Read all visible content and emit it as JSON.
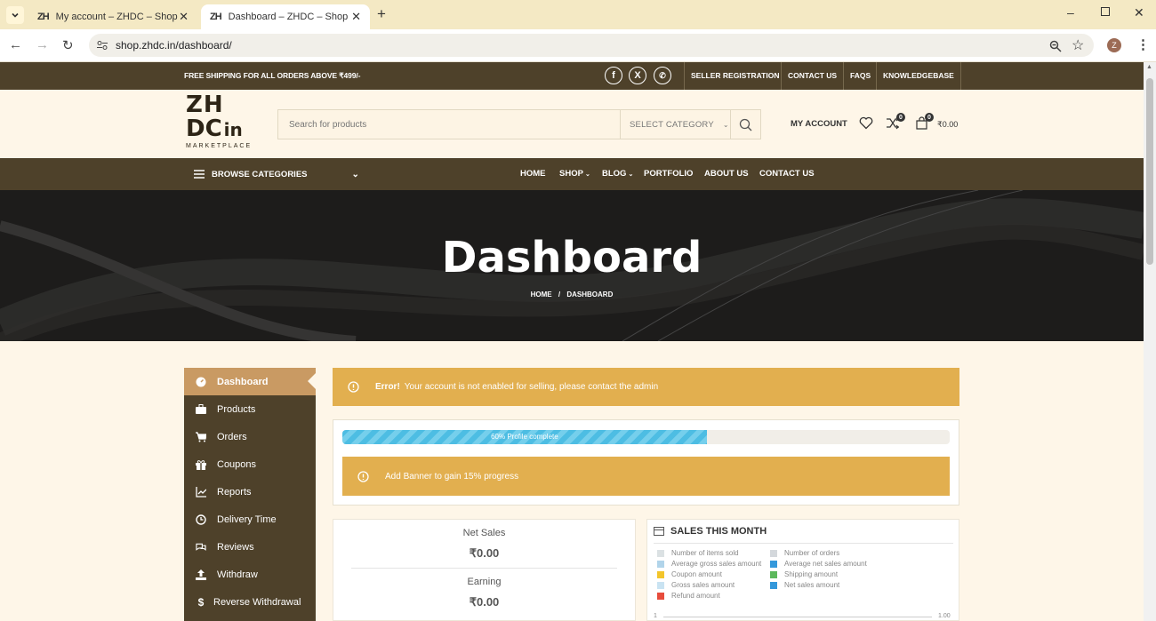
{
  "browser": {
    "tabs": [
      {
        "title": "My account – ZHDC – Shop",
        "favicon": "ZH"
      },
      {
        "title": "Dashboard – ZHDC – Shop",
        "favicon": "ZH"
      }
    ],
    "url": "shop.zhdc.in/dashboard/",
    "profile_initial": "Z"
  },
  "topbar": {
    "shipping_text": "FREE SHIPPING FOR ALL ORDERS ABOVE ₹499/-",
    "links": [
      "SELLER REGISTRATION",
      "CONTACT US",
      "FAQS",
      "KNOWLEDGEBASE"
    ],
    "social": [
      "facebook-icon",
      "x-icon",
      "whatsapp-icon"
    ]
  },
  "logo": {
    "line1": "ZH",
    "line2": "DC",
    "line2b": "in",
    "tagline": "MARKETPLACE"
  },
  "search": {
    "placeholder": "Search for products",
    "category": "SELECT CATEGORY"
  },
  "header": {
    "account": "MY ACCOUNT",
    "compare_count": "0",
    "cart_count": "0",
    "cart_total": "₹0.00"
  },
  "nav": {
    "browse": "BROWSE CATEGORIES",
    "items": [
      "HOME",
      "SHOP",
      "BLOG",
      "PORTFOLIO",
      "ABOUT US",
      "CONTACT US"
    ]
  },
  "hero": {
    "title": "Dashboard",
    "breadcrumb_home": "HOME",
    "breadcrumb_sep": "/",
    "breadcrumb_current": "DASHBOARD"
  },
  "sidebar": {
    "items": [
      {
        "label": "Dashboard",
        "icon": "gauge-icon"
      },
      {
        "label": "Products",
        "icon": "briefcase-icon"
      },
      {
        "label": "Orders",
        "icon": "cart-icon"
      },
      {
        "label": "Coupons",
        "icon": "gift-icon"
      },
      {
        "label": "Reports",
        "icon": "chart-icon"
      },
      {
        "label": "Delivery Time",
        "icon": "clock-icon"
      },
      {
        "label": "Reviews",
        "icon": "comments-icon"
      },
      {
        "label": "Withdraw",
        "icon": "upload-icon"
      },
      {
        "label": "Reverse Withdrawal",
        "icon": "dollar-icon"
      }
    ]
  },
  "alert": {
    "strong": "Error!",
    "text": "Your account is not enabled for selling, please contact the admin"
  },
  "progress": {
    "percent": 60,
    "label": "60% Profile complete",
    "tip": "Add Banner  to gain 15% progress"
  },
  "stats": {
    "net_sales_label": "Net Sales",
    "net_sales_value": "₹0.00",
    "earning_label": "Earning",
    "earning_value": "₹0.00"
  },
  "sales_chart": {
    "title": "SALES THIS MONTH",
    "legend_left": [
      "Number of items sold",
      "Average gross sales amount",
      "Coupon amount",
      "Gross sales amount",
      "Refund amount"
    ],
    "legend_right": [
      "Number of orders",
      "Average net sales amount",
      "Shipping amount",
      "Net sales amount"
    ],
    "colors_left": [
      "#dbe1e3",
      "#b1d4ea",
      "#f3c52b",
      "#c9e3f2",
      "#e74c3c"
    ],
    "colors_right": [
      "#d4d8dc",
      "#3498db",
      "#5cb85c",
      "#3498db"
    ],
    "axis_left": "1",
    "axis_right": "1.00"
  }
}
